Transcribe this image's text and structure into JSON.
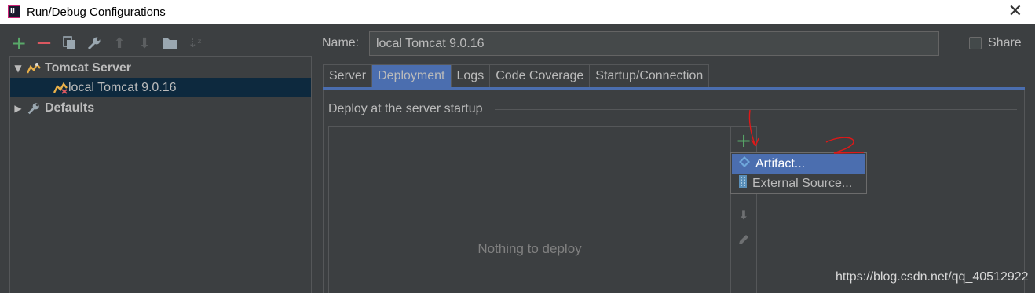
{
  "window": {
    "title": "Run/Debug Configurations",
    "close_label": "✕"
  },
  "left_toolbar": {
    "icons": [
      "add-icon",
      "remove-icon",
      "copy-icon",
      "wrench-icon",
      "move-up-icon",
      "move-down-icon",
      "folder-icon",
      "sort-icon"
    ]
  },
  "tree": {
    "items": [
      {
        "label": "Tomcat Server",
        "expanded": true,
        "icon": "tomcat-icon"
      },
      {
        "label": "local Tomcat 9.0.16",
        "selected": true,
        "icon": "tomcat-run-icon"
      },
      {
        "label": "Defaults",
        "expanded": false,
        "icon": "wrench-icon"
      }
    ]
  },
  "name_field": {
    "label": "Name:",
    "value": "local Tomcat 9.0.16"
  },
  "share": {
    "label": "Share",
    "checked": false
  },
  "tabs": [
    {
      "label": "Server"
    },
    {
      "label": "Deployment",
      "active": true
    },
    {
      "label": "Logs"
    },
    {
      "label": "Code Coverage"
    },
    {
      "label": "Startup/Connection"
    }
  ],
  "deployment": {
    "group_title": "Deploy at the server startup",
    "empty_text": "Nothing to deploy"
  },
  "popup": {
    "items": [
      {
        "label": "Artifact...",
        "icon": "artifact-icon",
        "selected": true
      },
      {
        "label": "External Source...",
        "icon": "external-source-icon"
      }
    ]
  },
  "watermark": "https://blog.csdn.net/qq_40512922",
  "colors": {
    "background": "#3c3f41",
    "selection": "#0d293e",
    "accent": "#4b6eaf",
    "add_green": "#59a869",
    "remove_red": "#db5860",
    "annotation_red": "#e01818"
  }
}
